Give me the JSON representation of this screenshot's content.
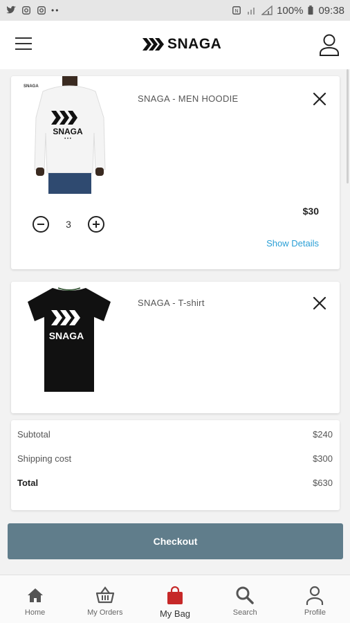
{
  "status_bar": {
    "battery": "100%",
    "time": "09:38"
  },
  "header": {
    "brand": "SNAGA"
  },
  "cart": {
    "items": [
      {
        "name": "SNAGA - MEN HOODIE",
        "price": "$30",
        "quantity": "3",
        "details_label": "Show Details",
        "image_print": "SNAGA"
      },
      {
        "name": "SNAGA - T-shirt",
        "image_print": "SNAGA"
      }
    ]
  },
  "summary": {
    "subtotal_label": "Subtotal",
    "subtotal_value": "$240",
    "shipping_label": "Shipping cost",
    "shipping_value": "$300",
    "total_label": "Total",
    "total_value": "$630"
  },
  "checkout_label": "Checkout",
  "bottom_nav": [
    {
      "label": "Home",
      "icon": "home-icon"
    },
    {
      "label": "My Orders",
      "icon": "basket-icon"
    },
    {
      "label": "My Bag",
      "icon": "bag-icon"
    },
    {
      "label": "Search",
      "icon": "search-icon"
    },
    {
      "label": "Profile",
      "icon": "person-icon"
    }
  ],
  "colors": {
    "accent": "#607d8b",
    "link": "#2a9fd6",
    "bag_active": "#c62828"
  }
}
